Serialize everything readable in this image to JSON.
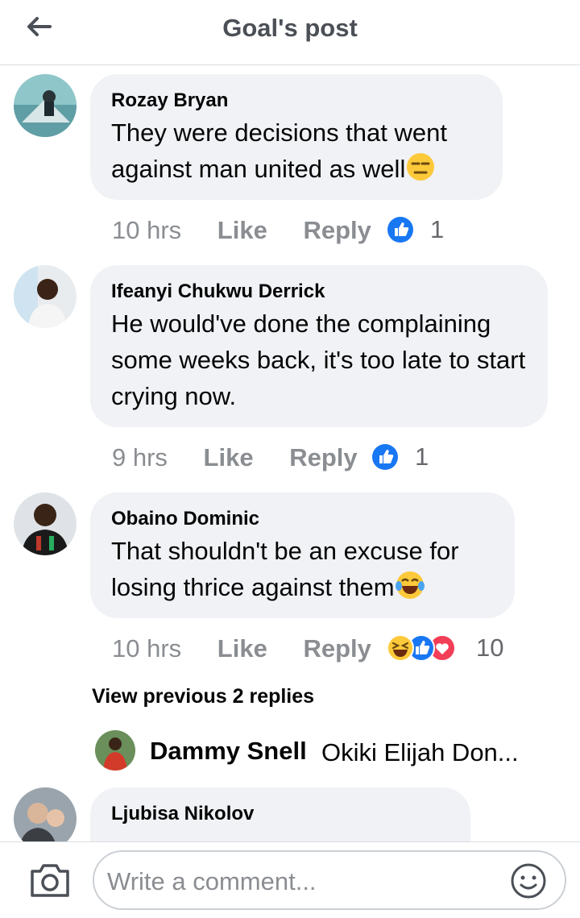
{
  "header": {
    "title": "Goal's post"
  },
  "comments": [
    {
      "name": "Rozay Bryan",
      "text": "They were decisions that went against man united as well",
      "emoji": "expressionless-face",
      "time": "10 hrs",
      "like": "Like",
      "reply": "Reply",
      "reactions": [
        "like"
      ],
      "count": "1"
    },
    {
      "name": "Ifeanyi Chukwu Derrick",
      "text": "He would've done the complaining some weeks back, it's too late to start crying now.",
      "time": "9 hrs",
      "like": "Like",
      "reply": "Reply",
      "reactions": [
        "like"
      ],
      "count": "1"
    },
    {
      "name": "Obaino Dominic",
      "text": "That shouldn't be an excuse for losing thrice against them",
      "emoji": "tears-of-joy-face",
      "time": "10 hrs",
      "like": "Like",
      "reply": "Reply",
      "reactions": [
        "haha",
        "like",
        "love"
      ],
      "count": "10"
    },
    {
      "name": "Ljubisa Nikolov",
      "text": ""
    }
  ],
  "view_previous": "View previous 2 replies",
  "reply_preview": {
    "name": "Dammy Snell",
    "text": "Okiki Elijah Don..."
  },
  "footer": {
    "placeholder": "Write a comment..."
  },
  "colors": {
    "like_blue": "#1877f2",
    "love_red": "#f33e58",
    "haha_yellow": "#fcc93a",
    "bubble": "#f0f2f5",
    "meta_gray": "#8a8d91"
  }
}
